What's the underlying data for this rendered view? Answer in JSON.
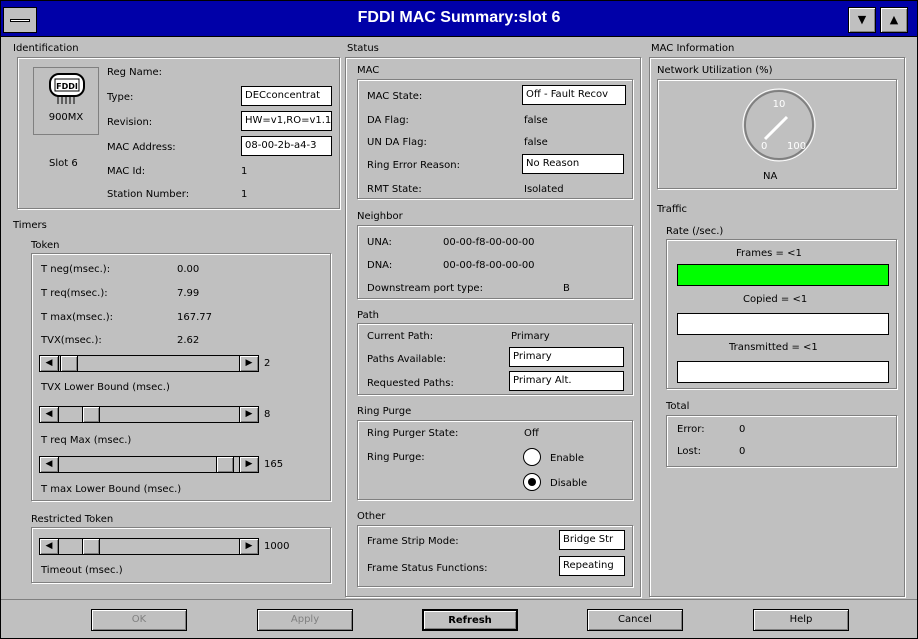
{
  "window": {
    "title": "FDDI MAC Summary:slot 6",
    "colors": {
      "titlebar": "#0000a8",
      "frames_bar": "#00ff00"
    }
  },
  "identification": {
    "label": "Identification",
    "device_logo": "FDDI",
    "device_model": "900MX",
    "slot": "Slot 6",
    "rows": [
      {
        "label": "Reg Name:",
        "value": ""
      },
      {
        "label": "Type:",
        "value": "DECconcentrat"
      },
      {
        "label": "Revision:",
        "value": "HW=v1,RO=v1.1,"
      },
      {
        "label": "MAC Address:",
        "value": "08-00-2b-a4-3"
      },
      {
        "label": "MAC Id:",
        "value": "1"
      },
      {
        "label": "Station Number:",
        "value": "1"
      }
    ]
  },
  "timers": {
    "label": "Timers",
    "token_label": "Token",
    "rows": [
      {
        "label": "T neg(msec.):",
        "value": "0.00"
      },
      {
        "label": "T req(msec.):",
        "value": "7.99"
      },
      {
        "label": "T max(msec.):",
        "value": "167.77"
      },
      {
        "label": "TVX(msec.):",
        "value": "2.62"
      }
    ],
    "sliders": [
      {
        "value": "2",
        "caption": "TVX Lower Bound (msec.)"
      },
      {
        "value": "8",
        "caption": "T req Max (msec.)"
      },
      {
        "value": "165",
        "caption": "T max Lower Bound (msec.)"
      }
    ],
    "restricted": {
      "label": "Restricted Token",
      "value": "1000",
      "caption": "Timeout (msec.)"
    }
  },
  "status": {
    "label": "Status",
    "mac": {
      "label": "MAC",
      "rows": [
        {
          "label": "MAC State:",
          "value": "Off - Fault Recov"
        },
        {
          "label": "DA Flag:",
          "value": "false"
        },
        {
          "label": "UN DA Flag:",
          "value": "false"
        },
        {
          "label": "Ring Error Reason:",
          "value": "No Reason"
        },
        {
          "label": "RMT State:",
          "value": "Isolated"
        }
      ]
    },
    "neighbor": {
      "label": "Neighbor",
      "rows": [
        {
          "label": "UNA:",
          "value": "00-00-f8-00-00-00"
        },
        {
          "label": "DNA:",
          "value": "00-00-f8-00-00-00"
        },
        {
          "label": "Downstream port type:",
          "value": "B"
        }
      ]
    },
    "path": {
      "label": "Path",
      "rows": [
        {
          "label": "Current Path:",
          "value": "Primary"
        },
        {
          "label": "Paths Available:",
          "value": "Primary"
        },
        {
          "label": "Requested Paths:",
          "value": "Primary Alt."
        }
      ]
    },
    "ring_purge": {
      "label": "Ring Purge",
      "state_label": "Ring Purger State:",
      "state_value": "Off",
      "purge_label": "Ring Purge:",
      "enable": "Enable",
      "disable": "Disable",
      "selected": "Disable"
    },
    "other": {
      "label": "Other",
      "rows": [
        {
          "label": "Frame Strip Mode:",
          "value": "Bridge Str"
        },
        {
          "label": "Frame Status Functions:",
          "value": "Repeating"
        }
      ]
    }
  },
  "mac_info": {
    "label": "MAC Information",
    "utilization": {
      "label": "Network Utilization (%)",
      "value": "NA",
      "gauge_min": "0",
      "gauge_mid": "10",
      "gauge_max": "100"
    },
    "traffic": {
      "label": "Traffic",
      "rate_label": "Rate (/sec.)",
      "frames": "Frames = <1",
      "copied": "Copied = <1",
      "transmitted": "Transmitted = <1",
      "frames_fill": 1.0,
      "copied_fill": 0,
      "transmitted_fill": 0
    },
    "total": {
      "label": "Total",
      "error_label": "Error:",
      "error_value": "0",
      "lost_label": "Lost:",
      "lost_value": "0"
    }
  },
  "buttons": {
    "ok": "OK",
    "apply": "Apply",
    "refresh": "Refresh",
    "cancel": "Cancel",
    "help": "Help"
  }
}
